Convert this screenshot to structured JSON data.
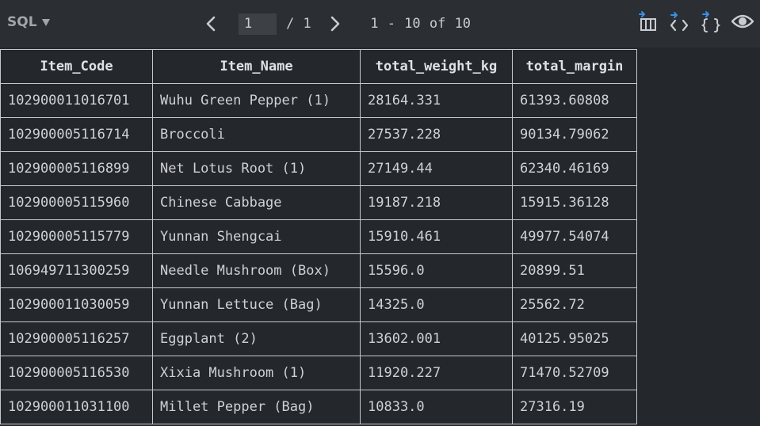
{
  "toolbar": {
    "mode_label": "SQL",
    "page_value": "1",
    "page_total": "/ 1",
    "range_text": "1 - 10 of 10",
    "icons": [
      "export-columns-icon",
      "code-view-icon",
      "json-view-icon",
      "preview-eye-icon"
    ],
    "accent_color": "#3b8eea"
  },
  "table": {
    "columns": [
      "Item_Code",
      "Item_Name",
      "total_weight_kg",
      "total_margin"
    ],
    "rows": [
      [
        "102900011016701",
        "Wuhu Green Pepper (1)",
        "28164.331",
        "61393.60808"
      ],
      [
        "102900005116714",
        "Broccoli",
        "27537.228",
        "90134.79062"
      ],
      [
        "102900005116899",
        "Net Lotus Root (1)",
        "27149.44",
        "62340.46169"
      ],
      [
        "102900005115960",
        "Chinese Cabbage",
        "19187.218",
        "15915.36128"
      ],
      [
        "102900005115779",
        "Yunnan Shengcai",
        "15910.461",
        "49977.54074"
      ],
      [
        "106949711300259",
        "Needle Mushroom (Box)",
        "15596.0",
        "20899.51"
      ],
      [
        "102900011030059",
        "Yunnan Lettuce (Bag)",
        "14325.0",
        "25562.72"
      ],
      [
        "102900005116257",
        "Eggplant (2)",
        "13602.001",
        "40125.95025"
      ],
      [
        "102900005116530",
        "Xixia Mushroom (1)",
        "11920.227",
        "71470.52709"
      ],
      [
        "102900011031100",
        "Millet Pepper (Bag)",
        "10833.0",
        "27316.19"
      ]
    ]
  }
}
